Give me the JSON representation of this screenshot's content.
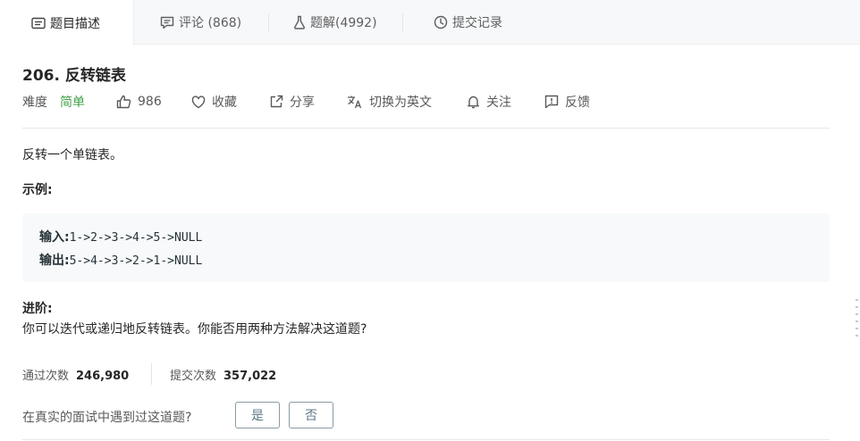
{
  "tabs": [
    {
      "label": "题目描述",
      "icon": "description-icon"
    },
    {
      "label": "评论 (868)",
      "icon": "comment-icon"
    },
    {
      "label": "题解(4992)",
      "icon": "flask-icon"
    },
    {
      "label": "提交记录",
      "icon": "clock-icon"
    }
  ],
  "problem": {
    "title": "206. 反转链表",
    "difficulty_label": "难度",
    "difficulty_value": "简单",
    "difficulty_color": "#43a047"
  },
  "meta": {
    "likes": "986",
    "favorite": "收藏",
    "share": "分享",
    "translate": "切换为英文",
    "follow": "关注",
    "feedback": "反馈"
  },
  "description": {
    "text": "反转一个单链表。",
    "example_heading": "示例:",
    "input_label": "输入:",
    "input_value": "1->2->3->4->5->NULL",
    "output_label": "输出:",
    "output_value": "5->4->3->2->1->NULL",
    "advanced_heading": "进阶:",
    "advanced_text": "你可以迭代或递归地反转链表。你能否用两种方法解决这道题?"
  },
  "stats": {
    "accepted_label": "通过次数",
    "accepted_value": "246,980",
    "submissions_label": "提交次数",
    "submissions_value": "357,022"
  },
  "interview": {
    "question": "在真实的面试中遇到过这道题?",
    "yes": "是",
    "no": "否"
  }
}
